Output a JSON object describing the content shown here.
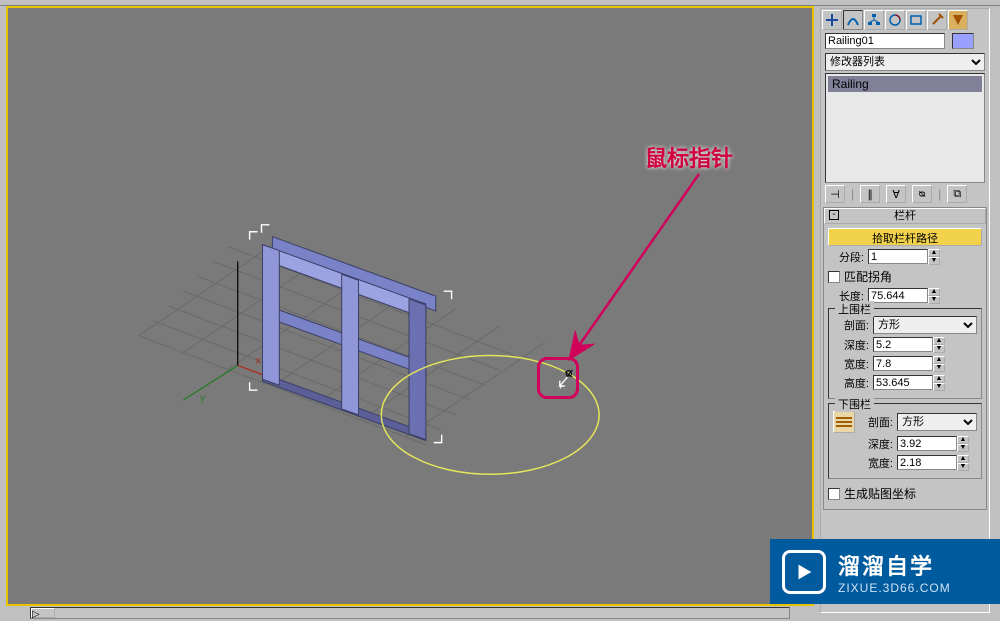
{
  "object_name": "Railing01",
  "modifier_list_label": "修改器列表",
  "mod_stack_item": "Railing",
  "annotation": {
    "label": "鼠标指针"
  },
  "rollout": {
    "title": "栏杆",
    "pick_path": "拾取栏杆路径",
    "segments_label": "分段:",
    "segments_value": "1",
    "match_corners_label": "匹配拐角",
    "length_label": "长度:",
    "length_value": "75.644"
  },
  "upper_rail": {
    "title": "上围栏",
    "profile_label": "剖面:",
    "profile_value": "方形",
    "depth_label": "深度:",
    "depth_value": "5.2",
    "width_label": "宽度:",
    "width_value": "7.8",
    "height_label": "高度:",
    "height_value": "53.645"
  },
  "lower_rail": {
    "title": "下围栏",
    "profile_label": "剖面:",
    "profile_value": "方形",
    "depth_label": "深度:",
    "depth_value": "3.92",
    "width_label": "宽度:",
    "width_value": "2.18"
  },
  "gen_uv_label": "生成贴图坐标",
  "watermark": {
    "brand": "溜溜自学",
    "url": "ZIXUE.3D66.COM"
  },
  "mod_toolbar": {
    "pin": "⊣",
    "sep": "|",
    "stack1": "∥",
    "stack2": "∀",
    "stack3": "ᴓ",
    "config": "⧉"
  }
}
